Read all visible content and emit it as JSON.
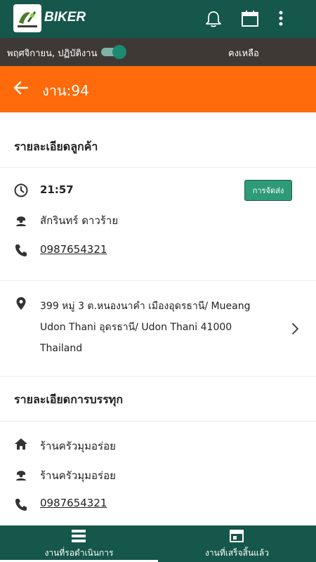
{
  "app": {
    "brand": "BIKER",
    "logo_text": "BIKER"
  },
  "status": {
    "date": "พฤศจิกายน, ปฏิบัติงาน",
    "remaining_label": "คงเหลือ",
    "on_duty": true
  },
  "job": {
    "title": "งาน:94"
  },
  "customer": {
    "section_title": "รายละเอียดลูกค้า",
    "time": "21:57",
    "status_button": "การจัดส่ง",
    "name": "สักรินทร์ ดาวร้าย",
    "phone": "0987654321",
    "address": "399 หมู่ 3 ต.หนองนาคำ เมืองอุดรธานี/ Mueang Udon Thani อุดรธานี/ Udon Thani 41000 Thailand"
  },
  "pickup": {
    "section_title": "รายละเอียดการบรรทุก",
    "store": "ร้านครัวมุมอร่อย",
    "contact": "ร้านครัวมุมอร่อย",
    "phone": "0987654321"
  },
  "bottom_nav": [
    {
      "label": "งานที่รอดำเนินการ",
      "icon": "list-icon",
      "active": true
    },
    {
      "label": "งานที่เสร็จสิ้นแล้ว",
      "icon": "completed-icon",
      "active": false
    }
  ],
  "colors": {
    "primary": "#15574a",
    "accent": "#ff6a0a",
    "status_bar": "#3e3935",
    "button": "#2e9a78"
  }
}
